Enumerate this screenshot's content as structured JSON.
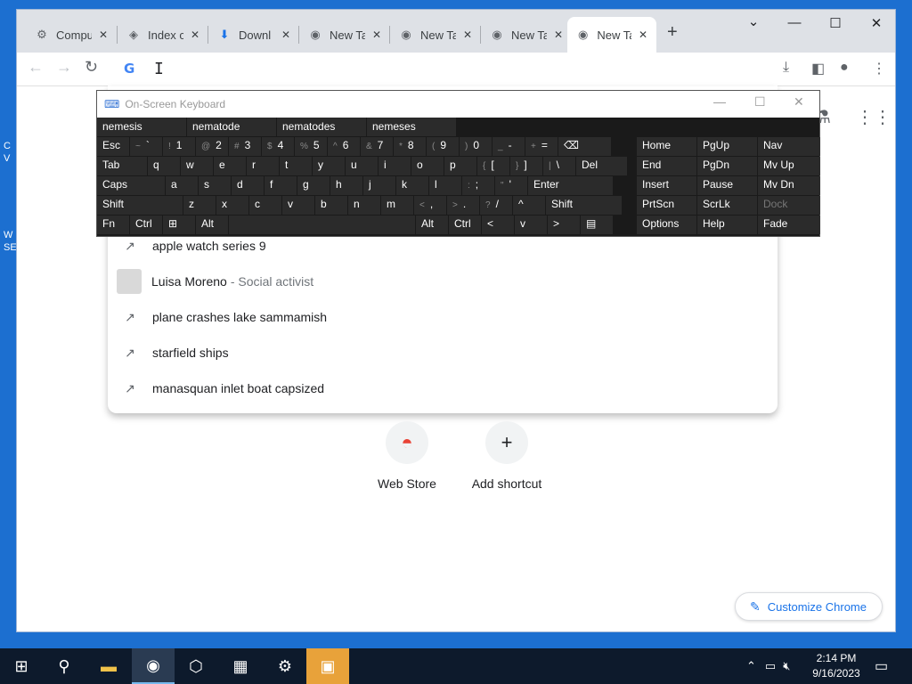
{
  "desktop": {
    "labels": [
      "C",
      "V",
      "W",
      "SE"
    ]
  },
  "tabs": [
    {
      "label": "Compu",
      "icon": "computer-icon"
    },
    {
      "label": "Index c",
      "icon": "file-icon"
    },
    {
      "label": "Downl",
      "icon": "download-icon"
    },
    {
      "label": "New Ta",
      "icon": "chrome-icon"
    },
    {
      "label": "New Ta",
      "icon": "chrome-icon"
    },
    {
      "label": "New Ta",
      "icon": "chrome-icon"
    },
    {
      "label": "New Ta",
      "icon": "chrome-icon"
    }
  ],
  "omnibox": {
    "value": ""
  },
  "suggestions": [
    {
      "text": "apple watch series 9",
      "sub": "",
      "icon": "trending-icon"
    },
    {
      "text": "Luisa Moreno",
      "sub": "- Social activist",
      "icon": "thumbnail"
    },
    {
      "text": "plane crashes lake sammamish",
      "sub": "",
      "icon": "trending-icon"
    },
    {
      "text": "starfield ships",
      "sub": "",
      "icon": "trending-icon"
    },
    {
      "text": "manasquan inlet boat capsized",
      "sub": "",
      "icon": "trending-icon"
    }
  ],
  "shortcuts": [
    {
      "label": "Web Store"
    },
    {
      "label": "Add shortcut"
    }
  ],
  "customize_label": "Customize Chrome",
  "osk": {
    "title": "On-Screen Keyboard",
    "predictions": [
      "nemesis",
      "nematode",
      "nematodes",
      "nemeses"
    ],
    "rows": [
      [
        {
          "label": "Esc"
        },
        {
          "shift": "~",
          "label": "`"
        },
        {
          "shift": "!",
          "label": "1"
        },
        {
          "shift": "@",
          "label": "2"
        },
        {
          "shift": "#",
          "label": "3"
        },
        {
          "shift": "$",
          "label": "4"
        },
        {
          "shift": "%",
          "label": "5"
        },
        {
          "shift": "^",
          "label": "6"
        },
        {
          "shift": "&",
          "label": "7"
        },
        {
          "shift": "*",
          "label": "8"
        },
        {
          "shift": "(",
          "label": "9"
        },
        {
          "shift": ")",
          "label": "0"
        },
        {
          "shift": "_",
          "label": "-"
        },
        {
          "shift": "+",
          "label": "="
        },
        {
          "label": "⌫"
        }
      ],
      [
        {
          "label": "Tab"
        },
        {
          "label": "q"
        },
        {
          "label": "w"
        },
        {
          "label": "e"
        },
        {
          "label": "r"
        },
        {
          "label": "t"
        },
        {
          "label": "y"
        },
        {
          "label": "u"
        },
        {
          "label": "i"
        },
        {
          "label": "o"
        },
        {
          "label": "p"
        },
        {
          "shift": "{",
          "label": "["
        },
        {
          "shift": "}",
          "label": "]"
        },
        {
          "shift": "|",
          "label": "\\"
        },
        {
          "label": "Del"
        }
      ],
      [
        {
          "label": "Caps"
        },
        {
          "label": "a"
        },
        {
          "label": "s"
        },
        {
          "label": "d"
        },
        {
          "label": "f"
        },
        {
          "label": "g"
        },
        {
          "label": "h"
        },
        {
          "label": "j"
        },
        {
          "label": "k"
        },
        {
          "label": "l"
        },
        {
          "shift": ":",
          "label": ";"
        },
        {
          "shift": "\"",
          "label": "'"
        },
        {
          "label": "Enter"
        }
      ],
      [
        {
          "label": "Shift"
        },
        {
          "label": "z"
        },
        {
          "label": "x"
        },
        {
          "label": "c"
        },
        {
          "label": "v"
        },
        {
          "label": "b"
        },
        {
          "label": "n"
        },
        {
          "label": "m"
        },
        {
          "shift": "<",
          "label": ","
        },
        {
          "shift": ">",
          "label": "."
        },
        {
          "shift": "?",
          "label": "/"
        },
        {
          "label": "^"
        },
        {
          "label": "Shift"
        }
      ],
      [
        {
          "label": "Fn"
        },
        {
          "label": "Ctrl"
        },
        {
          "label": "⊞"
        },
        {
          "label": "Alt"
        },
        {
          "label": ""
        },
        {
          "label": "Alt"
        },
        {
          "label": "Ctrl"
        },
        {
          "label": "<"
        },
        {
          "label": "v"
        },
        {
          "label": ">"
        },
        {
          "label": "▤"
        }
      ]
    ],
    "right_keys": [
      [
        "Home",
        "PgUp",
        "Nav"
      ],
      [
        "End",
        "PgDn",
        "Mv Up"
      ],
      [
        "Insert",
        "Pause",
        "Mv Dn"
      ],
      [
        "PrtScn",
        "ScrLk",
        "Dock"
      ],
      [
        "Options",
        "Help",
        "Fade"
      ]
    ]
  },
  "taskbar": {
    "items": [
      "windows-start-icon",
      "search-icon",
      "file-explorer-icon",
      "chrome-icon",
      "virtualbox-icon",
      "network-app-icon",
      "settings-app-icon",
      "store-icon"
    ]
  },
  "clock": {
    "time": "2:14 PM",
    "date": "9/16/2023"
  }
}
